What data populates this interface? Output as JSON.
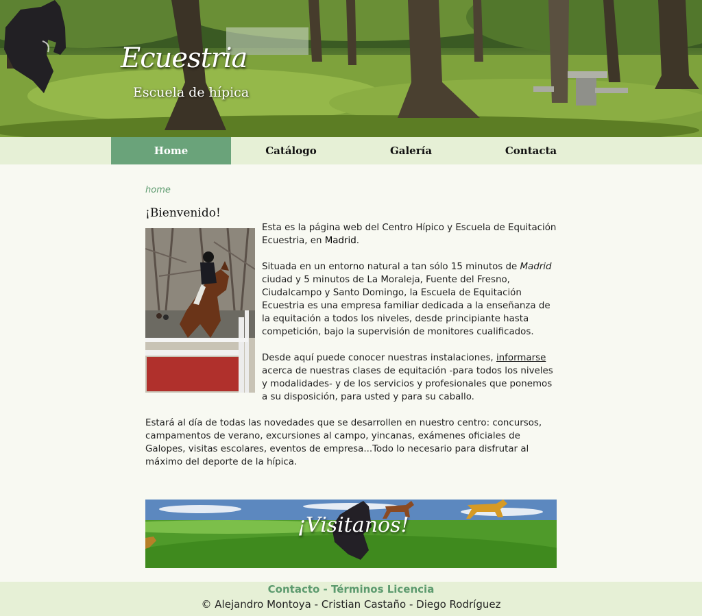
{
  "header": {
    "brand_name": "Ecuestria",
    "tagline": "Escuela de hípica"
  },
  "nav": {
    "items": [
      {
        "label": "Home",
        "active": true
      },
      {
        "label": "Catálogo",
        "active": false
      },
      {
        "label": "Galería",
        "active": false
      },
      {
        "label": "Contacta",
        "active": false
      }
    ]
  },
  "breadcrumb": "home",
  "main": {
    "title": "¡Bienvenido!",
    "p1_text": "Esta es la página web del Centro Hípico y Escuela de Equitación Ecuestria, en ",
    "p1_city": "Madrid",
    "p1_end": ".",
    "p2_start": "Situada en un entorno natural a tan sólo 15 minutos de ",
    "p2_city": "Madrid",
    "p2_rest": " ciudad y 5 minutos de La Moraleja, Fuente del Fresno, Ciudalcampo y Santo Domingo, la Escuela de Equitación Ecuestria es una empresa familiar dedicada a la enseñanza de la equitación a todos los niveles, desde principiante hasta competición, bajo la supervisión de monitores cualificados.",
    "p3_start": "Desde aquí puede conocer nuestras instalaciones, ",
    "p3_link": "informarse",
    "p3_rest": " acerca de nuestras clases de equitación -para todos los niveles y modalidades- y de los servicios y profesionales que ponemos a su disposición, para usted y para su caballo.",
    "p4": "Estará al día de todas las novedades que se desarrollen en nuestro centro: concursos, campamentos de verano, excursiones al campo, yincanas, exámenes oficiales de Galopes, visitas escolares, eventos de empresa...Todo lo necesario para disfrutar al máximo del deporte de la hípica."
  },
  "visit_banner": {
    "text": "¡Visitanos!"
  },
  "footer": {
    "contact_label": "Contacto",
    "separator": " - ",
    "terms_label": "Términos Licencia",
    "credit": "© Alejandro Montoya - Cristian Castaño - Diego Rodríguez"
  },
  "colors": {
    "accent_green": "#6aa37a",
    "nav_bg": "#e6f0d6",
    "link_green": "#5c9a6e",
    "page_bg": "#f8f9f2"
  },
  "icons": [
    "horse-head-logo-icon"
  ]
}
